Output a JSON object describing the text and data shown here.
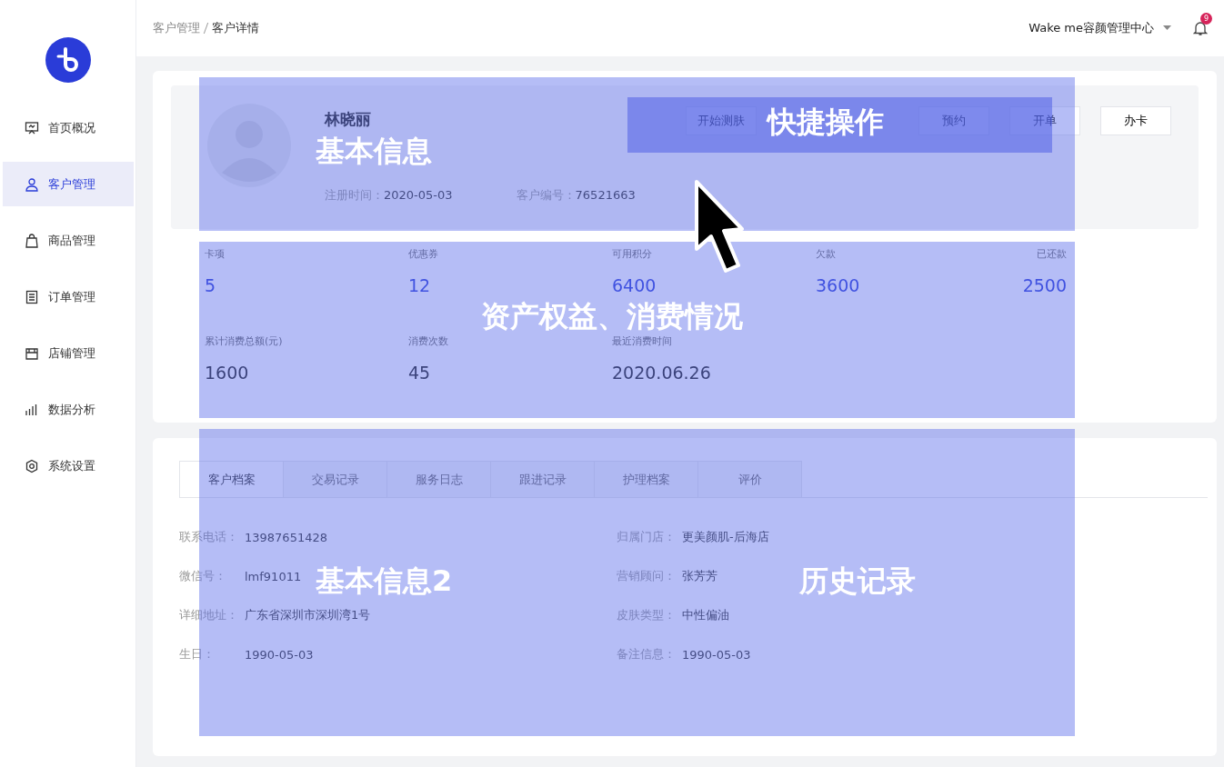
{
  "sidebar": {
    "items": [
      {
        "label": "首页概况",
        "selected": false
      },
      {
        "label": "客户管理",
        "selected": true
      },
      {
        "label": "商品管理",
        "selected": false
      },
      {
        "label": "订单管理",
        "selected": false
      },
      {
        "label": "店铺管理",
        "selected": false
      },
      {
        "label": "数据分析",
        "selected": false
      },
      {
        "label": "系统设置",
        "selected": false
      }
    ]
  },
  "header": {
    "breadcrumb": [
      "客户管理",
      "客户详情"
    ],
    "org": "Wake me容颜管理中心",
    "notifications": "9"
  },
  "profile": {
    "name": "林晓丽",
    "fields": [
      {
        "label": "注册时间：",
        "value": "2020-05-03"
      },
      {
        "label": "客户编号：",
        "value": "76521663"
      }
    ],
    "actions": [
      {
        "label": "开始测肤"
      },
      {
        "label": "预约"
      },
      {
        "label": "开单"
      },
      {
        "label": "办卡"
      }
    ]
  },
  "stats": [
    {
      "label": "卡项",
      "value": "5"
    },
    {
      "label": "优惠券",
      "value": "12"
    },
    {
      "label": "可用积分",
      "value": "6400"
    },
    {
      "label": "欠款",
      "value": "3600"
    },
    {
      "label": "已还款",
      "value": "2500"
    },
    {
      "label": "累计消费总额(元)",
      "value": "1600"
    },
    {
      "label": "消费次数",
      "value": "45"
    },
    {
      "label": "最近消费时间",
      "value": "2020.06.26"
    }
  ],
  "tabs": [
    {
      "label": "客户档案",
      "selected": true
    },
    {
      "label": "交易记录",
      "selected": false
    },
    {
      "label": "服务日志",
      "selected": false
    },
    {
      "label": "跟进记录",
      "selected": false
    },
    {
      "label": "护理档案",
      "selected": false
    },
    {
      "label": "评价",
      "selected": false
    }
  ],
  "details": [
    {
      "label": "联系电话：",
      "value": "13987651428"
    },
    {
      "label": "归属门店：",
      "value": "更美颜肌-后海店"
    },
    {
      "label": "微信号：",
      "value": "lmf91011"
    },
    {
      "label": "营销顾问：",
      "value": "张芳芳"
    },
    {
      "label": "详细地址：",
      "value": "广东省深圳市深圳湾1号"
    },
    {
      "label": "皮肤类型：",
      "value": "中性偏油"
    },
    {
      "label": "生日：",
      "value": "1990-05-03"
    },
    {
      "label": "备注信息：",
      "value": "1990-05-03"
    }
  ],
  "annotations": [
    {
      "kind": "light",
      "labels": [
        "基本信息"
      ]
    },
    {
      "kind": "dark",
      "labels": [
        "快捷操作"
      ]
    },
    {
      "kind": "light",
      "labels": [
        "资产权益、消费情况"
      ]
    },
    {
      "kind": "light",
      "labels": [
        "基本信息2",
        "历史记录"
      ]
    }
  ]
}
